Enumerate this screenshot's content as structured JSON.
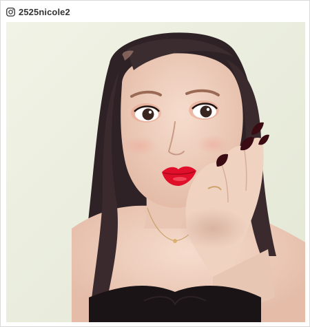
{
  "post": {
    "username": "2525nicole2",
    "platform_icon": "instagram-icon",
    "photo": {
      "subject": "portrait-photo",
      "colors": {
        "background": "#ecefe0",
        "hair": "#2e2226",
        "skin": "#f0d4c4",
        "lips": "#e0102a",
        "nails": "#3a0b12",
        "dress": "#1a1416"
      }
    }
  }
}
